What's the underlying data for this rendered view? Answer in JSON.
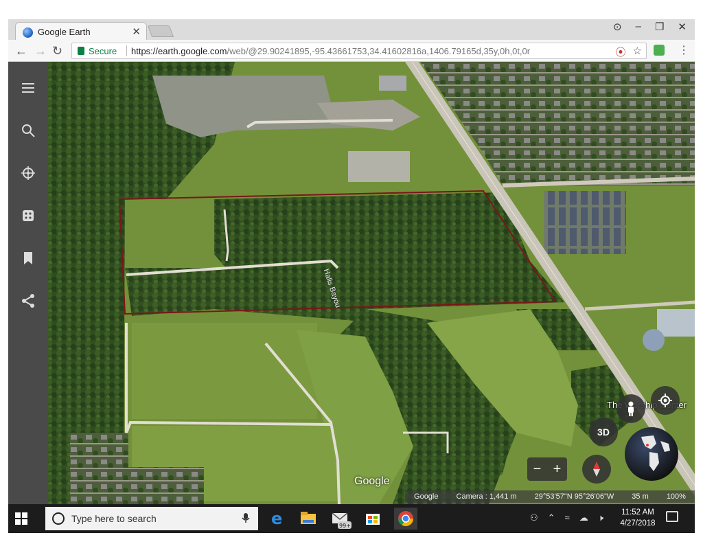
{
  "browser": {
    "tab_title": "Google Earth",
    "tab_close_icon": "close-icon",
    "new_tab_icon": "new-tab-icon",
    "window_controls": {
      "profile": "⊙",
      "minimize": "–",
      "maximize": "❐",
      "close": "✕"
    },
    "nav": {
      "back": "←",
      "forward": "→",
      "reload": "↻"
    },
    "secure_label": "Secure",
    "url_host": "https://earth.google.com",
    "url_path": "/web/@29.90241895,-95.43661753,34.41602816a,1406.79165d,35y,0h,0t,0r",
    "omnibox_icons": {
      "cast": "⦿",
      "bookmark": "☆"
    },
    "menu": "⋮"
  },
  "sidebar": {
    "items": [
      {
        "name": "menu-icon"
      },
      {
        "name": "search-icon"
      },
      {
        "name": "voyager-icon"
      },
      {
        "name": "feeling-lucky-icon"
      },
      {
        "name": "projects-icon"
      },
      {
        "name": "share-icon"
      }
    ]
  },
  "map": {
    "road_label": "Halls Bayou",
    "place_label": "The Worship Center",
    "logo": "Google",
    "controls": {
      "threed": "3D",
      "zoom_out": "−",
      "zoom_in": "+"
    },
    "status": {
      "attribution": "Google",
      "camera": "Camera : 1,441 m",
      "coords": "29°53'57\"N 95°26'06\"W",
      "altitude": "35 m",
      "zoom": "100%"
    },
    "colors": {
      "boundary": "#7a1717",
      "field": "#6c8a34",
      "forest": "#2d4a1c",
      "road": "#d7d2c4"
    }
  },
  "taskbar": {
    "search_placeholder": "Type here to search",
    "mail_badge": "99+",
    "clock_time": "11:52 AM",
    "clock_date": "4/27/2018",
    "apps": [
      {
        "name": "edge-icon"
      },
      {
        "name": "file-explorer-icon"
      },
      {
        "name": "mail-icon"
      },
      {
        "name": "store-icon"
      },
      {
        "name": "chrome-icon"
      }
    ]
  }
}
